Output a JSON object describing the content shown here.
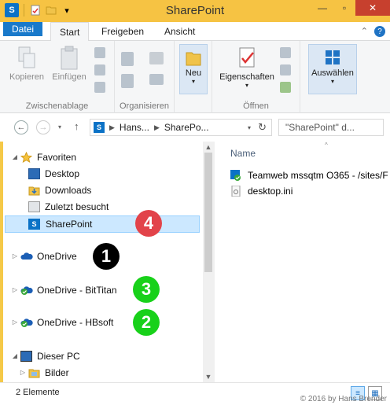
{
  "window": {
    "title": "SharePoint"
  },
  "qat": {
    "icons": [
      "sharepoint-app-icon",
      "properties-icon",
      "folder-icon",
      "dropdown-icon"
    ]
  },
  "tabs": [
    {
      "label": "Datei"
    },
    {
      "label": "Start"
    },
    {
      "label": "Freigeben"
    },
    {
      "label": "Ansicht"
    }
  ],
  "ribbon": {
    "groups": [
      {
        "label": "Zwischenablage",
        "buttons": [
          {
            "label": "Kopieren"
          },
          {
            "label": "Einfügen"
          }
        ]
      },
      {
        "label": "Organisieren"
      },
      {
        "label": "",
        "buttons": [
          {
            "label": "Neu"
          }
        ]
      },
      {
        "label": "Öffnen",
        "buttons": [
          {
            "label": "Eigenschaften"
          }
        ]
      },
      {
        "label": "",
        "buttons": [
          {
            "label": "Auswählen"
          }
        ]
      }
    ]
  },
  "address": {
    "crumbs": [
      "Hans...",
      "SharePo..."
    ],
    "search_placeholder": "\"SharePoint\" d..."
  },
  "nav": {
    "favorites_label": "Favoriten",
    "items": [
      {
        "label": "Desktop"
      },
      {
        "label": "Downloads"
      },
      {
        "label": "Zuletzt besucht"
      },
      {
        "label": "SharePoint"
      }
    ],
    "onedrives": [
      {
        "label": "OneDrive"
      },
      {
        "label": "OneDrive - BitTitan"
      },
      {
        "label": "OneDrive - HBsoft"
      }
    ],
    "pc_label": "Dieser PC",
    "pc_items": [
      {
        "label": "Bilder"
      }
    ]
  },
  "content": {
    "column_name": "Name",
    "files": [
      {
        "name": "Teamweb mssqtm O365 - /sites/F"
      },
      {
        "name": "desktop.ini"
      }
    ]
  },
  "badges": [
    {
      "number": "4",
      "color": "#e2434a"
    },
    {
      "number": "1",
      "color": "#000000"
    },
    {
      "number": "3",
      "color": "#18d11a"
    },
    {
      "number": "2",
      "color": "#18d11a"
    }
  ],
  "status": {
    "count": "2 Elemente",
    "copyright": "© 2016 by Hans Brender"
  }
}
